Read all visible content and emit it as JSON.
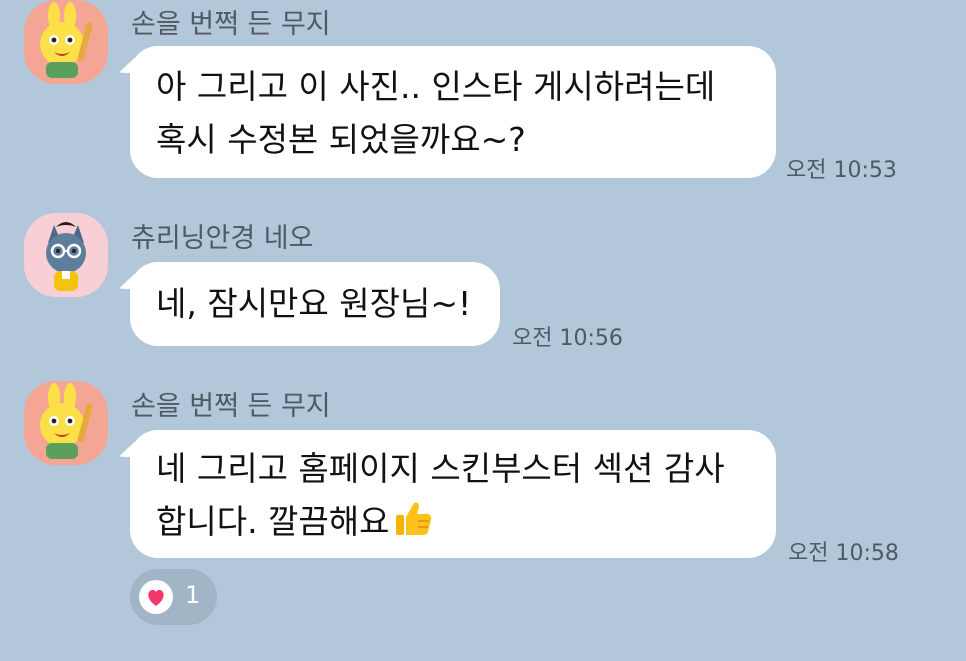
{
  "messages": [
    {
      "sender": "손을 번쩍 든 무지",
      "avatar_icon": "muzi-rabbit-avatar-icon",
      "lines": [
        "아 그리고 이 사진.. 인스타 게시하려는데",
        "혹시 수정본 되었을까요~?"
      ],
      "time": "오전 10:53"
    },
    {
      "sender": "츄리닝안경 네오",
      "avatar_icon": "neo-cat-avatar-icon",
      "lines": [
        "네, 잠시만요 원장님~!"
      ],
      "time": "오전 10:56"
    },
    {
      "sender": "손을 번쩍 든 무지",
      "avatar_icon": "muzi-rabbit-avatar-icon",
      "lines": [
        "네 그리고 홈페이지 스킨부스터 섹션 감사",
        "합니다. 깔끔해요"
      ],
      "trailing_icon": "thumbs-up-icon",
      "time": "오전 10:58",
      "reaction": {
        "icon": "heart-icon",
        "count": "1",
        "color": "#f2386b"
      }
    }
  ],
  "colors": {
    "background": "#b2c7d9",
    "bubble": "#ffffff",
    "reaction_pill": "#a2b5c6",
    "heart": "#f2386b",
    "muzi_avatar_bg": "#f5a593",
    "neo_avatar_bg": "#f7cfd4"
  }
}
